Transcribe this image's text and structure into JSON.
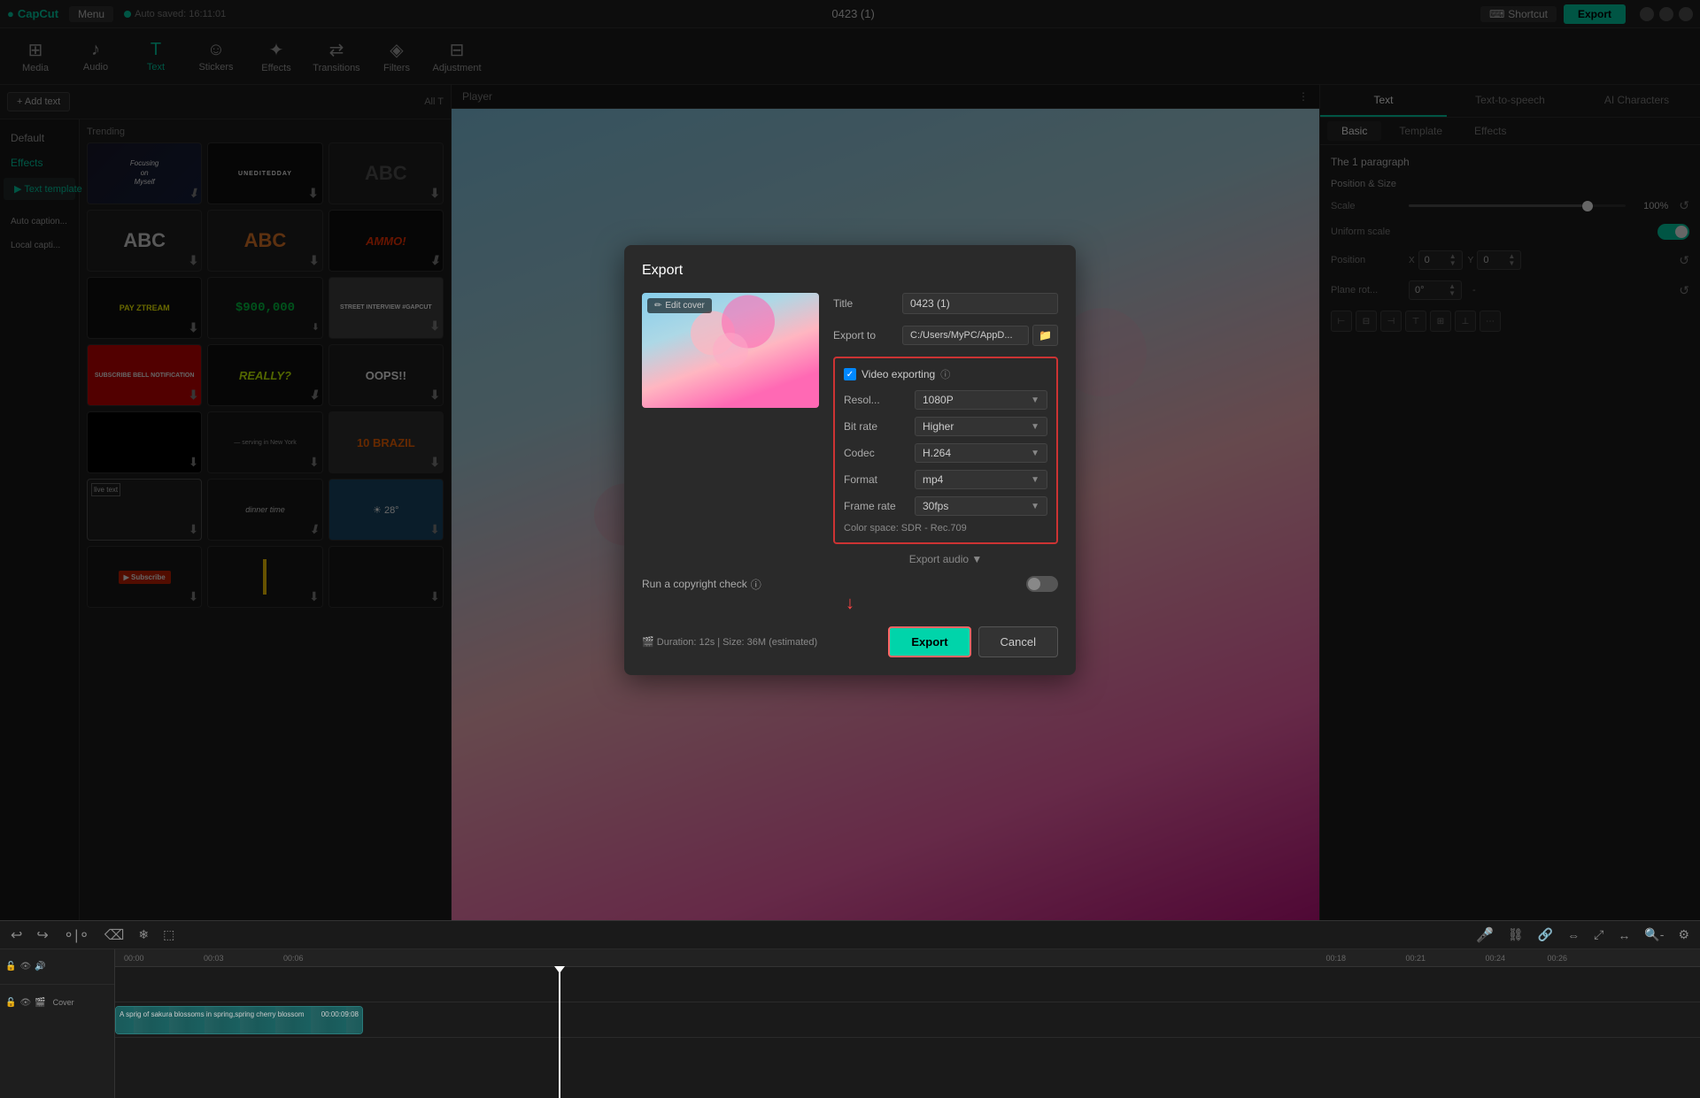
{
  "app": {
    "name": "CapCut",
    "title": "0423 (1)",
    "auto_save": "Auto saved: 16:11:01"
  },
  "top_bar": {
    "menu_label": "Menu",
    "shortcut_label": "Shortcut",
    "export_label": "Export"
  },
  "toolbar": {
    "items": [
      {
        "id": "media",
        "label": "Media",
        "icon": "⊞"
      },
      {
        "id": "audio",
        "label": "Audio",
        "icon": "♪"
      },
      {
        "id": "text",
        "label": "Text",
        "icon": "T",
        "active": true
      },
      {
        "id": "stickers",
        "label": "Stickers",
        "icon": "☺"
      },
      {
        "id": "effects",
        "label": "Effects",
        "icon": "✦"
      },
      {
        "id": "transitions",
        "label": "Transitions",
        "icon": "⇄"
      },
      {
        "id": "filters",
        "label": "Filters",
        "icon": "◈"
      },
      {
        "id": "adjustment",
        "label": "Adjustment",
        "icon": "⊟"
      }
    ]
  },
  "left_panel": {
    "add_text_label": "+ Add text",
    "all_label": "All T",
    "nav_items": [
      {
        "id": "default",
        "label": "Default"
      },
      {
        "id": "effects",
        "label": "Effects",
        "active": true
      },
      {
        "id": "text-template",
        "label": "▶ Text template",
        "sub": true
      }
    ],
    "auto_caption": "Auto caption...",
    "local_caption": "Local capti...",
    "trending_label": "Trending",
    "templates": [
      {
        "id": "focusing",
        "display": "Focusing on Myself",
        "style": "tmpl-focusing"
      },
      {
        "id": "unedited",
        "display": "UNEDITEDDAY",
        "style": "tmpl-unedited"
      },
      {
        "id": "abc1",
        "display": "ABC",
        "style": "tmpl-abc1"
      },
      {
        "id": "abc2",
        "display": "ABC",
        "style": "tmpl-abc2"
      },
      {
        "id": "abc3",
        "display": "ABC",
        "style": "tmpl-abc3"
      },
      {
        "id": "ammo",
        "display": "AMMO!",
        "style": "tmpl-ammo"
      },
      {
        "id": "pay",
        "display": "PAY ZTREAM",
        "style": "tmpl-pay"
      },
      {
        "id": "money",
        "display": "$900,000",
        "style": "tmpl-money"
      },
      {
        "id": "street",
        "display": "STREET INTERVIEW #GAPCUT",
        "style": "tmpl-street"
      },
      {
        "id": "subscribe",
        "display": "SUBSCRIBE BELL NOTIFICATION",
        "style": "tmpl-subscribe"
      },
      {
        "id": "really",
        "display": "REALLY?",
        "style": "tmpl-really"
      },
      {
        "id": "oops",
        "display": "OOPS!!",
        "style": "tmpl-oops"
      },
      {
        "id": "black",
        "display": "",
        "style": "tmpl-black"
      },
      {
        "id": "serving",
        "display": "Serving in New York",
        "style": "tmpl-serving"
      },
      {
        "id": "10brazil",
        "display": "10 BRAZIL",
        "style": "tmpl-10brazil"
      },
      {
        "id": "livetext",
        "display": "live text",
        "style": "tmpl-livetext"
      },
      {
        "id": "dinner",
        "display": "dinner time",
        "style": "tmpl-dinner"
      },
      {
        "id": "weather",
        "display": "☀ 28°",
        "style": "tmpl-weather"
      },
      {
        "id": "subscribe2",
        "display": "Subscribe",
        "style": "tmpl-subscribe2"
      },
      {
        "id": "yellow",
        "display": "|",
        "style": "tmpl-yellow-line"
      }
    ]
  },
  "player": {
    "label": "Player"
  },
  "right_panel": {
    "tabs": [
      {
        "id": "text",
        "label": "Text",
        "active": true
      },
      {
        "id": "text-to-speech",
        "label": "Text-to-speech"
      },
      {
        "id": "ai-characters",
        "label": "AI Characters"
      }
    ],
    "sub_tabs": [
      {
        "id": "basic",
        "label": "Basic",
        "active": true
      },
      {
        "id": "template",
        "label": "Template"
      },
      {
        "id": "effects",
        "label": "Effects"
      }
    ],
    "paragraph_label": "The 1 paragraph",
    "sections": {
      "position_size": {
        "label": "Position & Size",
        "scale_label": "Scale",
        "scale_value": "100%",
        "uniform_scale_label": "Uniform scale",
        "position_label": "Position",
        "x_label": "X",
        "x_value": "0",
        "y_label": "Y",
        "y_value": "0",
        "plane_rot_label": "Plane rot...",
        "plane_rot_value": "0°"
      }
    }
  },
  "export_modal": {
    "title": "Export",
    "title_label": "Title",
    "title_value": "0423 (1)",
    "export_to_label": "Export to",
    "export_path": "C:/Users/MyPC/AppD...",
    "edit_cover_label": "Edit cover",
    "video_exporting_label": "Video exporting",
    "info_icon": "ⓘ",
    "fields": [
      {
        "id": "resolution",
        "label": "Resol...",
        "value": "1080P"
      },
      {
        "id": "bit_rate",
        "label": "Bit rate",
        "value": "Higher"
      },
      {
        "id": "codec",
        "label": "Codec",
        "value": "H.264"
      },
      {
        "id": "format",
        "label": "Format",
        "value": "mp4"
      },
      {
        "id": "frame_rate",
        "label": "Frame rate",
        "value": "30fps"
      }
    ],
    "color_space": "Color space: SDR - Rec.709",
    "export_audio_label": "Export audio",
    "copyright_check_label": "Run a copyright check",
    "copyright_icon": "ⓘ",
    "duration_info": "Duration: 12s | Size: 36M (estimated)",
    "export_btn_label": "Export",
    "cancel_btn_label": "Cancel"
  },
  "timeline": {
    "clip_text": "A sprig of sakura blossoms in spring,spring cherry blossom",
    "clip_duration": "00:00:09:08",
    "cover_label": "Cover",
    "ruler_marks": [
      "00:00",
      "00:03",
      "00:06"
    ],
    "ruler_marks_right": [
      "00:18",
      "00:21",
      "00:24",
      "00:26"
    ]
  }
}
